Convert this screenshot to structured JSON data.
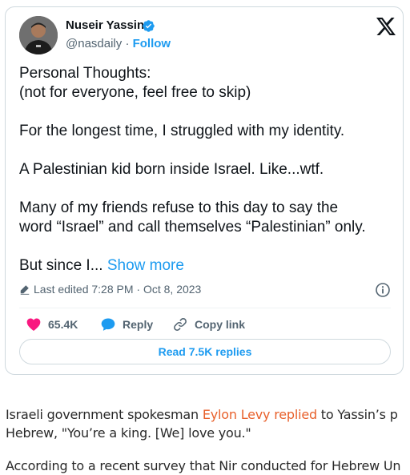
{
  "tweet": {
    "author_name": "Nuseir Yassin",
    "handle": "@nasdaily",
    "separator": "·",
    "follow_label": "Follow",
    "text_lines": [
      "Personal Thoughts:",
      "(not for everyone, feel free to skip)",
      "For the longest time, I struggled with my identity.",
      "A Palestinian kid born inside Israel. Like...wtf.",
      "Many of my friends refuse to this day to say the",
      "word “Israel” and call themselves “Palestinian” only.",
      "But since I... "
    ],
    "show_more_label": "Show more",
    "edited_label": "Last edited 7:28 PM · Oct 8, 2023",
    "likes_count": "65.4K",
    "reply_label": "Reply",
    "copy_link_label": "Copy link",
    "read_replies_label": "Read 7.5K replies",
    "colors": {
      "accent": "#1d9bf0",
      "like": "#f91880",
      "muted": "#536471"
    },
    "icons": {
      "verified": "verified-badge-icon",
      "logo": "x-logo-icon",
      "edit": "pencil-icon",
      "info": "info-icon",
      "like": "heart-icon",
      "reply": "speech-bubble-icon",
      "copy_link": "link-icon"
    }
  },
  "article": {
    "p1_before": "Israeli government spokesman ",
    "p1_link": "Eylon Levy replied",
    "p1_after": " to Yassin’s p",
    "p1_line2": "Hebrew, \"You’re a king. [We] love you.\"",
    "p2_line1": "According to a recent survey that Nir conducted for Hebrew Un",
    "link_color": "#e8612c"
  }
}
